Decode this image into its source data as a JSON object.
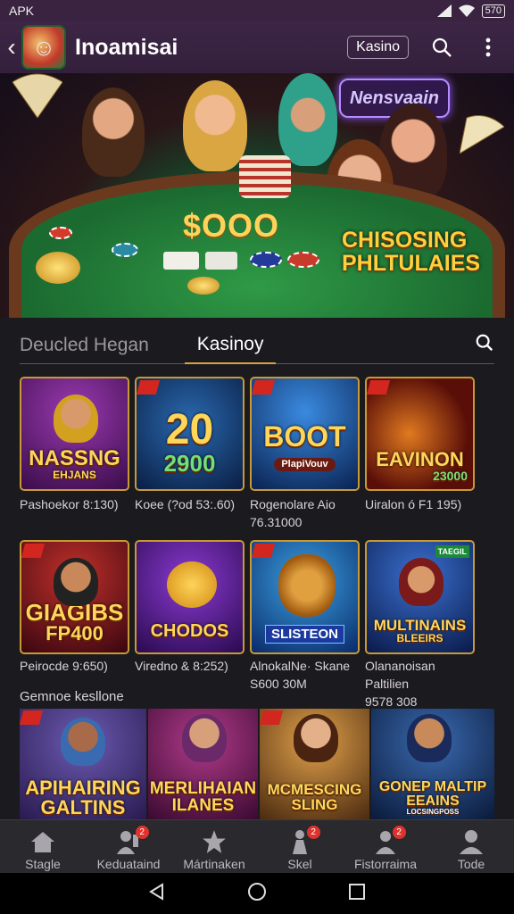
{
  "status": {
    "left": "APK",
    "battery": "570"
  },
  "appbar": {
    "title": "Inoamisai",
    "chip": "Kasino"
  },
  "hero": {
    "neon_sign": "Nensvaain",
    "pot": "$OOO",
    "promo": "CHISOSING PHLTULAIES"
  },
  "tabs": [
    {
      "label": "Deucled Hegan"
    },
    {
      "label": "Kasinoy"
    }
  ],
  "row1": [
    {
      "title": "NASSNG",
      "subtitle": "EHJANS",
      "caption": "Pashoekor 8:130)",
      "caption2": "",
      "bg": "#5a1a6a"
    },
    {
      "title": "20",
      "subtitle": "2900",
      "caption": "Koee (?od 53:.60)",
      "caption2": "",
      "bg": "#123a6a"
    },
    {
      "title": "BOOT",
      "subtitle": "PlapiVouv",
      "caption": "Rogenolare Aio",
      "caption2": "76.31000",
      "bg": "#0e3a70"
    },
    {
      "title": "EAVINON",
      "subtitle": "23000",
      "caption": "Uiralon ó F1 195)",
      "caption2": "",
      "bg": "#6a1a10"
    }
  ],
  "row2": [
    {
      "title": "GIAGIBS",
      "subtitle": "FP400",
      "caption": "Peirocde 9:650)",
      "caption2": "",
      "bg": "#6a1020"
    },
    {
      "title": "CHODOS",
      "subtitle": "",
      "caption": "Viredno & 8:252)",
      "caption2": "",
      "bg": "#4a1a7a"
    },
    {
      "title": "SLISTEON",
      "subtitle": "",
      "caption": "AlnokalNe· Skane",
      "caption2": "S600 30M",
      "bg": "#1a3a80"
    },
    {
      "title": "MULTINAINS",
      "subtitle": "BLEEIRS",
      "caption": "Olananoisan Paltilien",
      "caption2": "9578 308",
      "bg": "#1a3470",
      "tag": "TAEGIL"
    }
  ],
  "section_label": "Gemnoe kesllone",
  "row3": [
    {
      "title": "APIHAIRING GALTINS",
      "bg": "#3a2a60"
    },
    {
      "title": "MERLIHAIAN ILANES",
      "bg": "#5a1a4a"
    },
    {
      "title": "MCMESCING SLING",
      "bg": "#5a3a20"
    },
    {
      "title": "GONEP MALTIP EEAINS",
      "bg": "#1a2a50",
      "subtitle": "LOCSINGPOSS"
    }
  ],
  "bottom_nav": [
    {
      "label": "Stagle",
      "icon": "home-icon",
      "badge": ""
    },
    {
      "label": "Keduataind",
      "icon": "dealer-icon",
      "badge": "2"
    },
    {
      "label": "Mártinaken",
      "icon": "star-icon",
      "badge": ""
    },
    {
      "label": "Skel",
      "icon": "skill-icon",
      "badge": "2"
    },
    {
      "label": "Fistorraima",
      "icon": "chat-icon",
      "badge": "2"
    },
    {
      "label": "Tode",
      "icon": "profile-icon",
      "badge": ""
    }
  ]
}
